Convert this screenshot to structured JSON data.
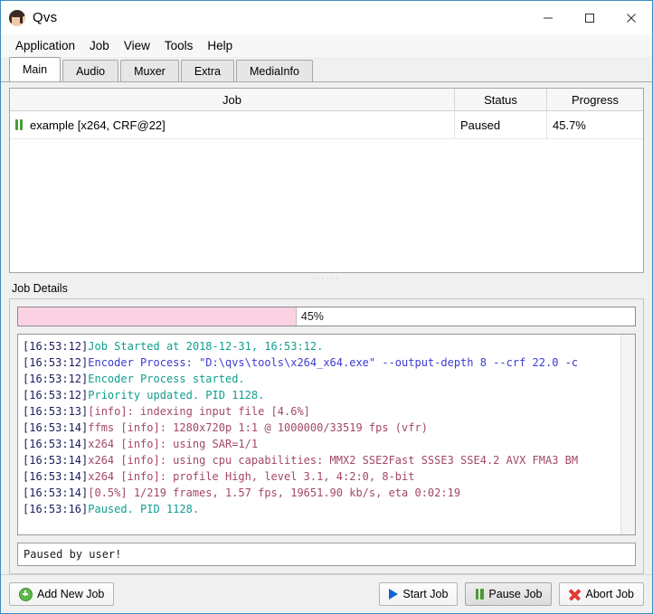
{
  "window": {
    "title": "Qvs",
    "icon": "app-avatar-icon",
    "controls": [
      {
        "name": "minimize",
        "glyph": "minimize-icon"
      },
      {
        "name": "maximize",
        "glyph": "maximize-icon"
      },
      {
        "name": "close",
        "glyph": "close-icon"
      }
    ]
  },
  "menubar": {
    "items": [
      {
        "label": "Application"
      },
      {
        "label": "Job"
      },
      {
        "label": "View"
      },
      {
        "label": "Tools"
      },
      {
        "label": "Help"
      }
    ]
  },
  "tabs": [
    {
      "label": "Main",
      "selected": true
    },
    {
      "label": "Audio",
      "selected": false
    },
    {
      "label": "Muxer",
      "selected": false
    },
    {
      "label": "Extra",
      "selected": false
    },
    {
      "label": "MediaInfo",
      "selected": false
    }
  ],
  "job_table": {
    "columns": [
      "Job",
      "Status",
      "Progress"
    ],
    "rows": [
      {
        "icon": "pause-icon",
        "job": "example [x264, CRF@22]",
        "status": "Paused",
        "progress": "45.7%"
      }
    ]
  },
  "details": {
    "label": "Job Details",
    "progress": {
      "percent_text": "45%",
      "percent_value": 45,
      "fill_color": "#fbd2e3"
    },
    "log": [
      {
        "time": "[16:53:12]",
        "segments": [
          {
            "text": "Job Started at 2018-12-31, 16:53:12.",
            "color": "teal"
          }
        ]
      },
      {
        "time": "[16:53:12]",
        "segments": [
          {
            "text": "Encoder Process: \"D:\\qvs\\tools\\x264_x64.exe\" --output-depth 8 --crf 22.0 -c",
            "color": "blue"
          }
        ]
      },
      {
        "time": "[16:53:12]",
        "segments": [
          {
            "text": "Encoder Process started.",
            "color": "teal"
          }
        ]
      },
      {
        "time": "[16:53:12]",
        "segments": [
          {
            "text": "Priority updated. PID 1128.",
            "color": "teal"
          }
        ]
      },
      {
        "time": "[16:53:13]",
        "segments": [
          {
            "text": "[info]: indexing input file [4.6%]",
            "color": "mauve"
          }
        ]
      },
      {
        "time": "[16:53:14]",
        "segments": [
          {
            "text": "ffms [info]: 1280x720p 1:1 @ 1000000/33519 fps (vfr)",
            "color": "mauve"
          }
        ]
      },
      {
        "time": "[16:53:14]",
        "segments": [
          {
            "text": "x264 [info]: using SAR=1/1",
            "color": "mauve"
          }
        ]
      },
      {
        "time": "[16:53:14]",
        "segments": [
          {
            "text": "x264 [info]: using cpu capabilities: MMX2 SSE2Fast SSSE3 SSE4.2 AVX FMA3 BM",
            "color": "mauve"
          }
        ]
      },
      {
        "time": "[16:53:14]",
        "segments": [
          {
            "text": "x264 [info]: profile High, level 3.1, 4:2:0, 8-bit",
            "color": "mauve"
          }
        ]
      },
      {
        "time": "[16:53:14]",
        "segments": [
          {
            "text": "[0.5%] 1/219 frames, 1.57 fps, 19651.90 kb/s, eta 0:02:19",
            "color": "mauve"
          }
        ]
      },
      {
        "time": "[16:53:16]",
        "segments": [
          {
            "text": "Paused. PID 1128.",
            "color": "teal"
          }
        ]
      }
    ],
    "status_message": "Paused by user!"
  },
  "bottom_buttons": {
    "add_new_job": {
      "label": "Add New Job",
      "icon": "plus-circle-icon"
    },
    "start_job": {
      "label": "Start Job",
      "icon": "play-icon"
    },
    "pause_job": {
      "label": "Pause Job",
      "icon": "pause-icon",
      "hover": true
    },
    "abort_job": {
      "label": "Abort Job",
      "icon": "cross-icon"
    }
  },
  "colors": {
    "accent": "#3a8dc4",
    "progress_fill": "#fbd2e3",
    "pause_green": "#4a9a36",
    "play_blue": "#1563d6",
    "abort_red": "#e03b35",
    "add_green": "#5eb84a"
  }
}
